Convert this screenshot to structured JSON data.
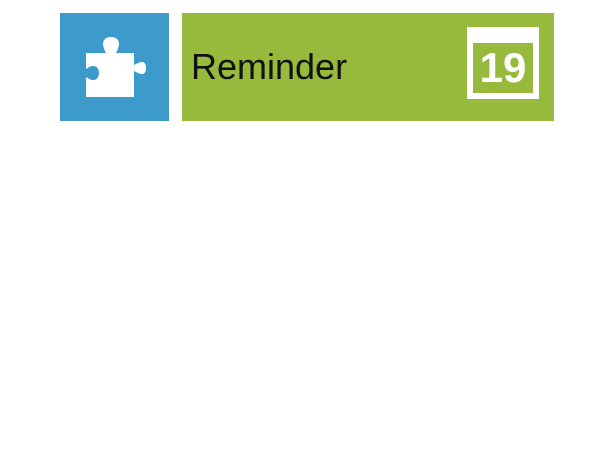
{
  "tiles": [
    {
      "name": "extensions",
      "icon": "puzzle-piece-icon",
      "background_color": "#3d9bcc"
    },
    {
      "name": "reminder",
      "title": "Reminder",
      "icon": "calendar-icon",
      "calendar_day": "19",
      "background_color": "#97b93c"
    }
  ]
}
